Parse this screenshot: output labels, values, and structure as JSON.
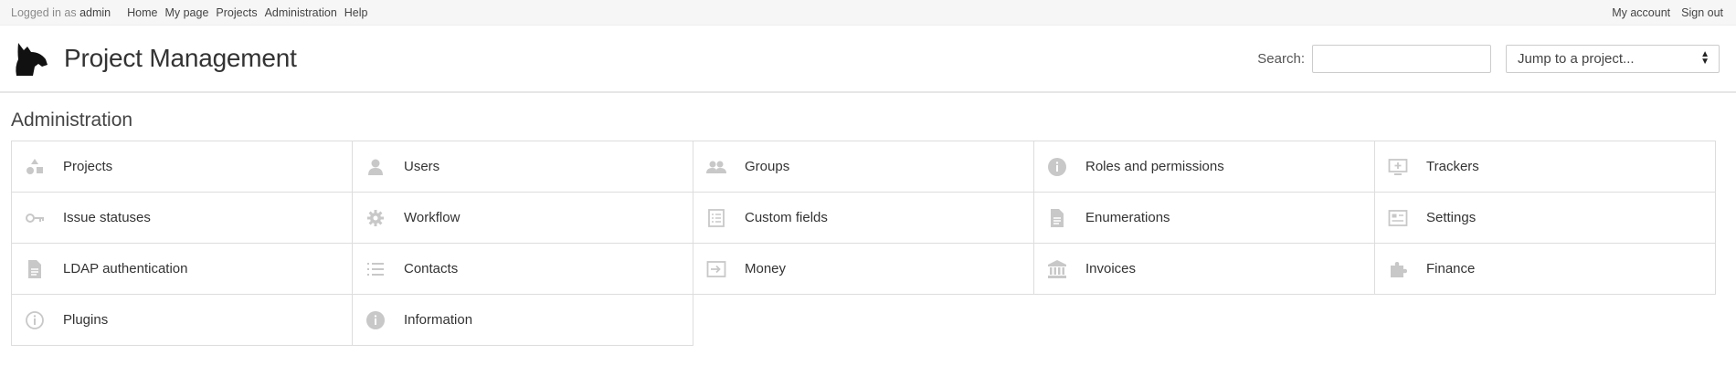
{
  "top_menu": {
    "logged_in_prefix": "Logged in as",
    "username": "admin",
    "links": [
      "Home",
      "My page",
      "Projects",
      "Administration",
      "Help"
    ],
    "account": "My account",
    "signout": "Sign out"
  },
  "header": {
    "title": "Project Management",
    "search_label": "Search:",
    "search_value": "",
    "jump_label": "Jump to a project..."
  },
  "page": {
    "title": "Administration"
  },
  "admin_items": [
    {
      "label": "Projects",
      "icon": "projects-icon"
    },
    {
      "label": "Users",
      "icon": "user-icon"
    },
    {
      "label": "Groups",
      "icon": "group-icon"
    },
    {
      "label": "Roles and permissions",
      "icon": "info-icon"
    },
    {
      "label": "Trackers",
      "icon": "monitor-icon"
    },
    {
      "label": "Issue statuses",
      "icon": "key-icon"
    },
    {
      "label": "Workflow",
      "icon": "gear-icon"
    },
    {
      "label": "Custom fields",
      "icon": "list-icon"
    },
    {
      "label": "Enumerations",
      "icon": "document-icon"
    },
    {
      "label": "Settings",
      "icon": "settings-icon"
    },
    {
      "label": "LDAP authentication",
      "icon": "document-icon"
    },
    {
      "label": "Contacts",
      "icon": "list-lines-icon"
    },
    {
      "label": "Money",
      "icon": "login-icon"
    },
    {
      "label": "Invoices",
      "icon": "bank-icon"
    },
    {
      "label": "Finance",
      "icon": "puzzle-icon"
    },
    {
      "label": "Plugins",
      "icon": "info-outline-icon"
    },
    {
      "label": "Information",
      "icon": "info-icon"
    }
  ],
  "colors": {
    "icon": "#c8c8c8",
    "border": "#dddddd",
    "text": "#333333"
  }
}
